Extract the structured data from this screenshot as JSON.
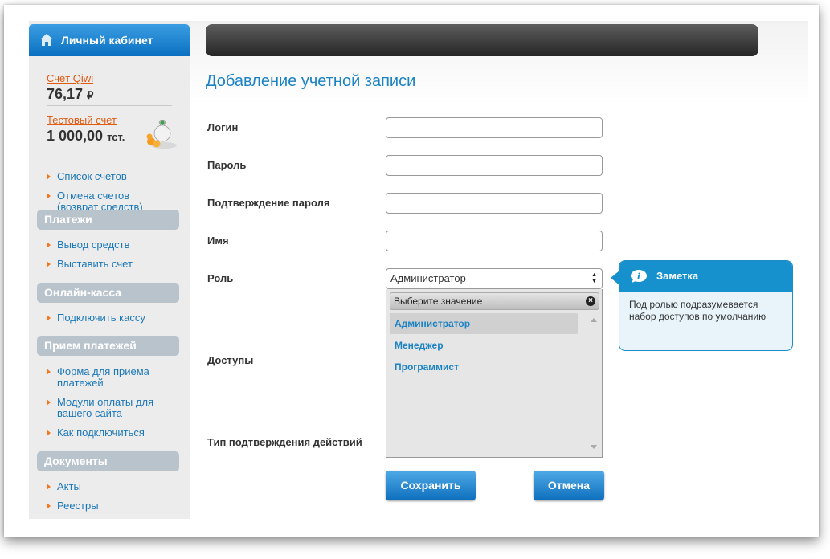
{
  "sidebar": {
    "header": "Личный кабинет",
    "qiwi_label": "Счёт Qiwi",
    "qiwi_amount": "76,17",
    "qiwi_currency": "₽",
    "test_label": "Тестовый счет",
    "test_amount": "1 000,00",
    "test_currency": "тст.",
    "accounts_menu": [
      "Список счетов",
      "Отмена счетов (возврат средств)"
    ],
    "sections": [
      {
        "title": "Платежи",
        "items": [
          "Вывод средств",
          "Выставить счет"
        ]
      },
      {
        "title": "Онлайн-касса",
        "items": [
          "Подключить кассу"
        ]
      },
      {
        "title": "Прием платежей",
        "items": [
          "Форма для приема платежей",
          "Модули оплаты для вашего сайта",
          "Как подключиться"
        ]
      },
      {
        "title": "Документы",
        "items": [
          "Акты",
          "Реестры"
        ]
      }
    ]
  },
  "main": {
    "title": "Добавление учетной записи",
    "fields": {
      "login": "Логин",
      "password": "Пароль",
      "confirm": "Подтверждение пароля",
      "name": "Имя",
      "role": "Роль",
      "access": "Доступы",
      "confirm_type": "Тип подтверждения действий"
    },
    "role_value": "Администратор",
    "dropdown": {
      "header": "Выберите значение",
      "options": [
        "Администратор",
        "Менеджер",
        "Программист"
      ]
    },
    "save_label": "Сохранить",
    "cancel_label": "Отмена"
  },
  "note": {
    "title": "Заметка",
    "text": "Под ролью подразумевается набор доступов по умолчанию"
  },
  "colors": {
    "accent": "#1b83c4",
    "link_orange": "#e05a10",
    "button_blue": "#0d6fbd",
    "section_gray": "#b9c3cb"
  }
}
